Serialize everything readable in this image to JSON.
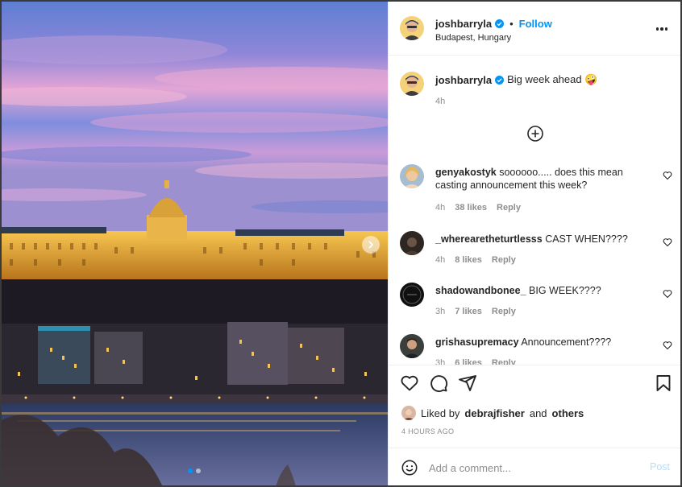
{
  "post": {
    "author": "joshbarryla",
    "location": "Budapest, Hungary",
    "follow_label": "Follow",
    "bullet": "•",
    "caption": "Big week ahead 🤪",
    "caption_time": "4h",
    "image_description_icon": "photo-of-buda-castle"
  },
  "comments": [
    {
      "user": "genyakostyk",
      "text": "soooooo..... does this mean casting announcement this week?",
      "time": "4h",
      "likes": "38 likes",
      "reply": "Reply"
    },
    {
      "user": "_wherearetheturtlesss",
      "text": "CAST WHEN????",
      "time": "4h",
      "likes": "8 likes",
      "reply": "Reply"
    },
    {
      "user": "shadowandbonee_",
      "text": "BIG WEEK????",
      "time": "3h",
      "likes": "7 likes",
      "reply": "Reply"
    },
    {
      "user": "grishasupremacy",
      "text": "Announcement????",
      "time": "3h",
      "likes": "6 likes",
      "reply": "Reply"
    }
  ],
  "likes": {
    "prefix": "Liked by",
    "user": "debrajfisher",
    "middle": "and",
    "others": "others"
  },
  "posted_ago": "4 HOURS AGO",
  "composer": {
    "placeholder": "Add a comment...",
    "post_label": "Post"
  },
  "colors": {
    "accent": "#0095f6",
    "post_disabled": "#b2dffc",
    "secondary_text": "#8e8e8e"
  },
  "icons": [
    "verified-badge-icon",
    "more-options-icon",
    "add-circle-icon",
    "heart-icon",
    "comment-icon",
    "share-icon",
    "bookmark-icon",
    "emoji-icon",
    "next-arrow-icon"
  ]
}
